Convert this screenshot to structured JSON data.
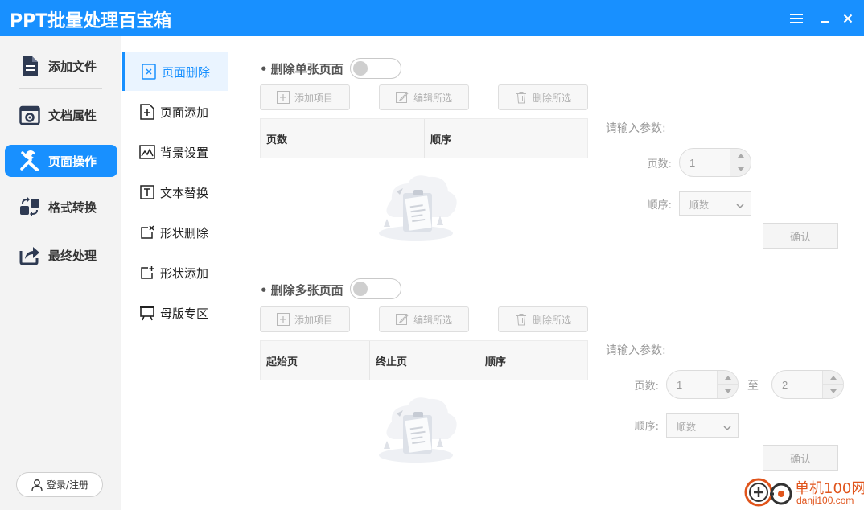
{
  "app": {
    "title": "PPT批量处理百宝箱"
  },
  "sidebar": {
    "items": [
      {
        "label": "添加文件",
        "icon": "document-icon"
      },
      {
        "label": "文档属性",
        "icon": "properties-icon"
      },
      {
        "label": "页面操作",
        "icon": "tools-icon",
        "active": true
      },
      {
        "label": "格式转换",
        "icon": "convert-icon"
      },
      {
        "label": "最终处理",
        "icon": "share-icon"
      }
    ],
    "login_label": "登录/注册"
  },
  "subnav": {
    "items": [
      {
        "label": "页面删除",
        "icon": "page-delete-icon",
        "active": true
      },
      {
        "label": "页面添加",
        "icon": "page-add-icon"
      },
      {
        "label": "背景设置",
        "icon": "background-icon"
      },
      {
        "label": "文本替换",
        "icon": "text-icon"
      },
      {
        "label": "形状删除",
        "icon": "shape-delete-icon"
      },
      {
        "label": "形状添加",
        "icon": "shape-add-icon"
      },
      {
        "label": "母版专区",
        "icon": "master-icon"
      }
    ]
  },
  "single": {
    "title": "删除单张页面",
    "toggle_on": false,
    "buttons": {
      "add": "添加项目",
      "edit": "编辑所选",
      "delete": "删除所选"
    },
    "columns": [
      "页数",
      "顺序"
    ],
    "params": {
      "title": "请输入参数:",
      "pages_label": "页数:",
      "pages_value": "1",
      "order_label": "顺序:",
      "order_value": "顺数",
      "confirm": "确认"
    }
  },
  "multi": {
    "title": "删除多张页面",
    "toggle_on": false,
    "buttons": {
      "add": "添加项目",
      "edit": "编辑所选",
      "delete": "删除所选"
    },
    "columns": [
      "起始页",
      "终止页",
      "顺序"
    ],
    "params": {
      "title": "请输入参数:",
      "pages_label": "页数:",
      "from_value": "1",
      "to_label": "至",
      "to_value": "2",
      "order_label": "顺序:",
      "order_value": "顺数",
      "confirm": "确认"
    }
  },
  "watermark": {
    "name": "单机100网",
    "url": "danji100.com"
  },
  "colors": {
    "accent": "#1890ff",
    "sidebar_bg": "#f3f3f3",
    "watermark": "#e0541b"
  }
}
